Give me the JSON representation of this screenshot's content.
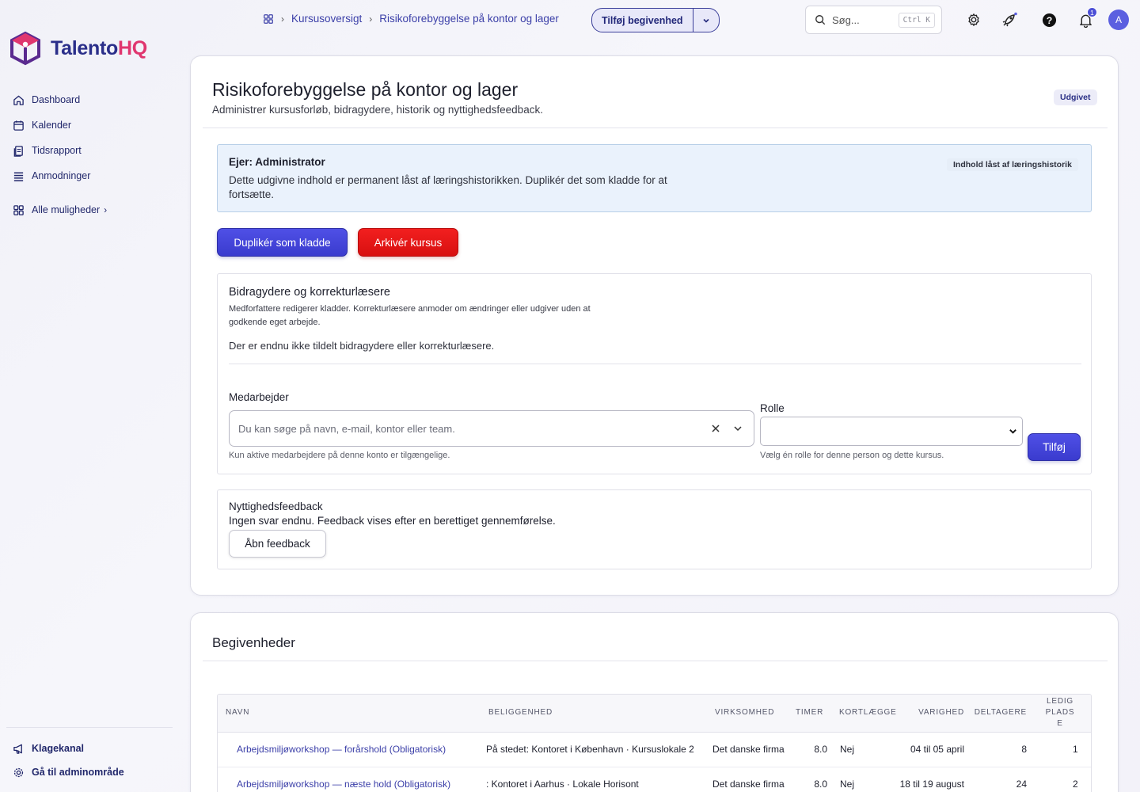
{
  "app": {
    "logo_main": "Talento",
    "logo_accent": "HQ"
  },
  "sidebar": {
    "items": [
      {
        "label": "Dashboard",
        "icon": "home-icon"
      },
      {
        "label": "Kalender",
        "icon": "calendar-icon"
      },
      {
        "label": "Tidsrapport",
        "icon": "document-icon"
      },
      {
        "label": "Anmodninger",
        "icon": "list-icon"
      }
    ],
    "more_label": "Alle muligheder",
    "bottom": [
      {
        "label": "Klagekanal",
        "icon": "megaphone-icon"
      },
      {
        "label": "Gå til adminområde",
        "icon": "gear-icon"
      }
    ]
  },
  "topbar": {
    "breadcrumb": [
      "Kursusoversigt",
      "Risikoforebyggelse på kontor og lager"
    ],
    "add_event_label": "Tilføj begivenhed",
    "search_placeholder": "Søg...",
    "search_shortcut": "Ctrl K",
    "notification_count": "1",
    "avatar_initial": "A"
  },
  "course": {
    "title": "Risikoforebyggelse på kontor og lager",
    "subtitle": "Administrer kursusforløb, bidragydere, historik og nyttighedsfeedback.",
    "status": "Udgivet",
    "owner": "Ejer: Administrator",
    "lock_notice": "Dette udgivne indhold er permanent låst af læringshistorikken. Duplikér det som kladde for at fortsætte.",
    "lock_badge": "Indhold låst af læringshistorik",
    "duplicate_label": "Duplikér som kladde",
    "archive_label": "Arkivér kursus"
  },
  "contributors": {
    "title": "Bidragydere og korrekturlæsere",
    "description": "Medforfattere redigerer kladder. Korrekturlæsere anmoder om ændringer eller udgiver uden at godkende eget arbejde.",
    "empty": "Der er endnu ikke tildelt bidragydere eller korrekturlæsere.",
    "employee_label": "Medarbejder",
    "employee_placeholder": "Du kan søge på navn, e-mail, kontor eller team.",
    "employee_hint": "Kun aktive medarbejdere på denne konto er tilgængelige.",
    "role_label": "Rolle",
    "role_value": "",
    "role_hint": "Vælg én rolle for denne person og dette kursus.",
    "add_label": "Tilføj"
  },
  "feedback": {
    "title": "Nyttighedsfeedback",
    "text": "Ingen svar endnu. Feedback vises efter en berettiget gennemførelse.",
    "open_label": "Åbn feedback"
  },
  "events": {
    "title": "Begivenheder",
    "columns": [
      "NAVN",
      "BELIGGENHED",
      "VIRKSOMHED",
      "TIMER",
      "KORTLÆGGE",
      "VARIGHED",
      "DELTAGERE",
      "LEDIG PLADSE"
    ],
    "rows": [
      [
        "Arbejdsmiljøworkshop — forårshold (Obligatorisk)",
        "På stedet: Kontoret i København · Kursuslokale 2",
        "Det danske firma",
        "8.0",
        "Nej",
        "04 til 05 april",
        "8",
        "1"
      ],
      [
        "Arbejdsmiljøworkshop — næste hold (Obligatorisk)",
        ": Kontoret i Aarhus · Lokale Horisont",
        "Det danske firma",
        "8.0",
        "Nej",
        "18 til 19 august",
        "24",
        "2"
      ]
    ]
  }
}
